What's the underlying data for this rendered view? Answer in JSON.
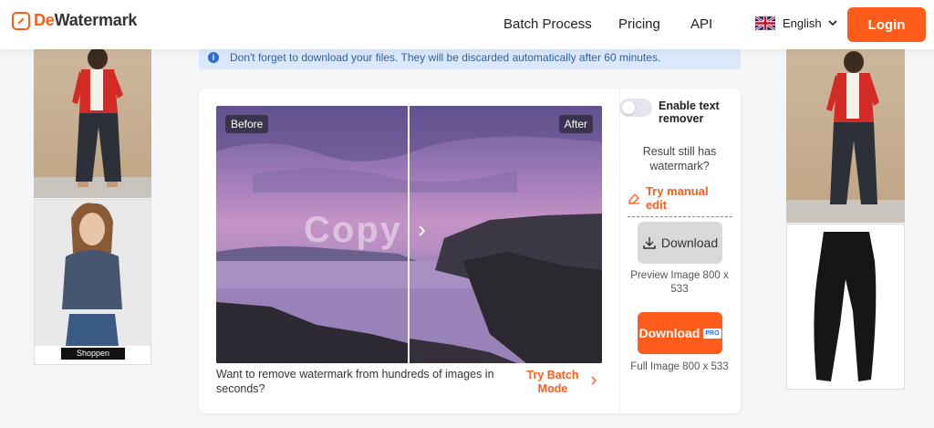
{
  "header": {
    "logo_text_accent": "De",
    "logo_text_rest": "Watermark",
    "nav": [
      "Batch Process",
      "Pricing",
      "API"
    ],
    "language": "English",
    "login_label": "Login"
  },
  "notice": {
    "text": "Don't forget to download your files. They will be discarded automatically after 60 minutes."
  },
  "compare": {
    "before_label": "Before",
    "after_label": "After",
    "watermark_text": "Copy"
  },
  "batch": {
    "question": "Want to remove watermark from hundreds of images in seconds?",
    "link": "Try Batch Mode"
  },
  "panel": {
    "toggle_label": "Enable text remover",
    "still_watermark": "Result still has watermark?",
    "manual_edit": "Try manual edit",
    "download_label": "Download",
    "preview_caption": "Preview Image 800 x 533",
    "download_pro_label": "Download",
    "pro_badge": "PRO",
    "full_caption": "Full Image 800 x 533"
  },
  "ads": {
    "shoppen_label": "Shoppen"
  },
  "colors": {
    "accent": "#ff5b1a",
    "notice_bg": "#dbe8fb"
  }
}
